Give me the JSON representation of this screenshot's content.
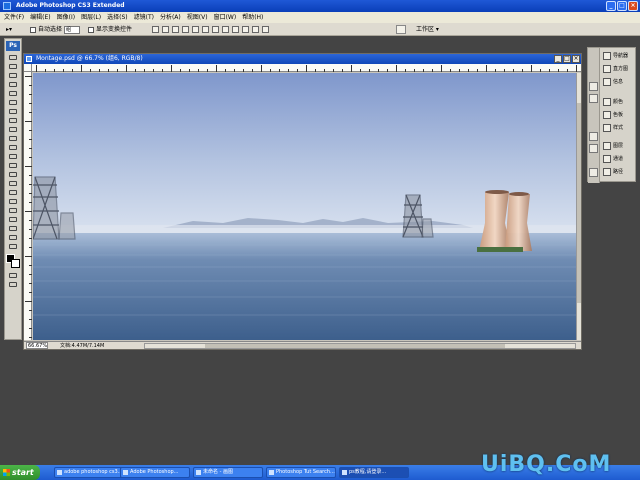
{
  "window": {
    "title": "Adobe Photoshop CS3 Extended"
  },
  "menu": [
    "文件(F)",
    "编辑(E)",
    "图像(I)",
    "图层(L)",
    "选择(S)",
    "滤镜(T)",
    "分析(A)",
    "视图(V)",
    "窗口(W)",
    "帮助(H)"
  ],
  "options": {
    "auto_select_label": "自动选择",
    "auto_select_value": "组",
    "show_transform_label": "显示变换控件",
    "workspace_label": "工作区 ▾"
  },
  "tools": {
    "logo": "Ps",
    "items": [
      "move-tool",
      "marquee-tool",
      "lasso-tool",
      "quick-select-tool",
      "crop-tool",
      "slice-tool",
      "healing-tool",
      "brush-tool",
      "stamp-tool",
      "history-brush-tool",
      "eraser-tool",
      "gradient-tool",
      "blur-tool",
      "dodge-tool",
      "pen-tool",
      "type-tool",
      "path-select-tool",
      "shape-tool",
      "notes-tool",
      "eyedropper-tool",
      "hand-tool",
      "zoom-tool"
    ]
  },
  "document": {
    "title": "Montage.psd @ 66.7% (组6, RGB/8)",
    "zoom": "66.67%",
    "info": "文档:4.47M/7.14M"
  },
  "panels": {
    "groups": [
      {
        "items": [
          {
            "label": "导航器",
            "icon": "navigator-icon"
          },
          {
            "label": "直方图",
            "icon": "histogram-icon"
          },
          {
            "label": "信息",
            "icon": "info-icon"
          }
        ]
      },
      {
        "items": [
          {
            "label": "颜色",
            "icon": "color-icon"
          },
          {
            "label": "色板",
            "icon": "swatches-icon"
          },
          {
            "label": "样式",
            "icon": "styles-icon"
          }
        ]
      },
      {
        "items": [
          {
            "label": "图层",
            "icon": "layers-icon"
          },
          {
            "label": "通道",
            "icon": "channels-icon"
          },
          {
            "label": "路径",
            "icon": "paths-icon"
          }
        ]
      }
    ]
  },
  "taskbar": {
    "start_label": "start",
    "tasks": [
      {
        "label": "adobe photoshop cs3..."
      },
      {
        "label": "Adobe Photoshop..."
      },
      {
        "label": "未命名 - 画图"
      },
      {
        "label": "Photoshop Tut Search..."
      },
      {
        "label": "ps教程,请登录..."
      }
    ]
  },
  "watermark": "UiBQ.CoM",
  "colors": {
    "xp_blue": "#1f58d6",
    "sky_top": "#8da3d2",
    "water": "#4c6d98"
  }
}
